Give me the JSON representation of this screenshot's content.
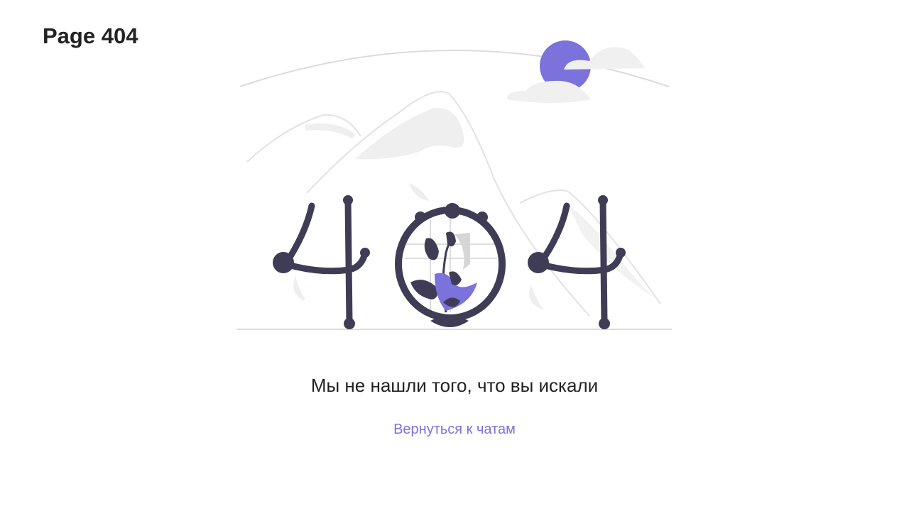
{
  "header": {
    "title": "Page 404"
  },
  "illustration": {
    "icon": "not-found-404-illustration",
    "digits": [
      "4",
      "0",
      "4"
    ],
    "colors": {
      "digit": "#3f3d56",
      "accent": "#7b72dc",
      "scenery": "#f2f2f2",
      "scenery_line": "#e0e0e0"
    }
  },
  "main": {
    "message": "Мы не нашли того, что вы искали",
    "back_link": "Вернуться к чатам"
  },
  "colors": {
    "accent": "#7b72dc",
    "text": "#222222",
    "background": "#ffffff"
  }
}
